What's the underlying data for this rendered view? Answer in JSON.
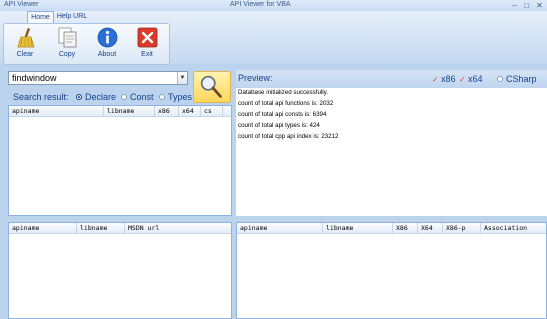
{
  "window": {
    "left_title": "API Viewer",
    "center_title": "API Viewer for VBA",
    "minimize": "–",
    "maximize": "□",
    "close": "✕"
  },
  "tabs": [
    {
      "label": "Home"
    },
    {
      "label": "Help URL"
    }
  ],
  "ribbon": {
    "buttons": [
      {
        "label": "Clear",
        "icon": "broom-icon"
      },
      {
        "label": "Copy",
        "icon": "copy-icon"
      },
      {
        "label": "About",
        "icon": "info-icon"
      },
      {
        "label": "Exit",
        "icon": "exit-icon"
      }
    ]
  },
  "search": {
    "value": "findwindow",
    "result_label": "Search result:",
    "options": [
      "Declare",
      "Const",
      "Types"
    ],
    "selected": "Declare"
  },
  "preview": {
    "label": "Preview:",
    "opt_x86": "x86",
    "opt_x64": "x64",
    "opt_csharp": "CSharp",
    "lines": [
      "Database initialized successfully.",
      "count of total api functions is: 2032",
      "count of total api consts is: 6394",
      "count of total api types is: 424",
      "count of total cpp api index is: 23212"
    ]
  },
  "results_table": {
    "columns": [
      "apiname",
      "libname",
      "x86",
      "x64",
      "cs"
    ]
  },
  "bottom_left_table": {
    "columns": [
      "apiname",
      "libname",
      "MSDN url"
    ]
  },
  "bottom_right_table": {
    "columns": [
      "apiname",
      "libname",
      "X86",
      "X64",
      "X86-p",
      "Association"
    ]
  },
  "colors": {
    "accent": "#15428b",
    "background": "#bcd3ee",
    "highlight": "#ffd65a"
  }
}
